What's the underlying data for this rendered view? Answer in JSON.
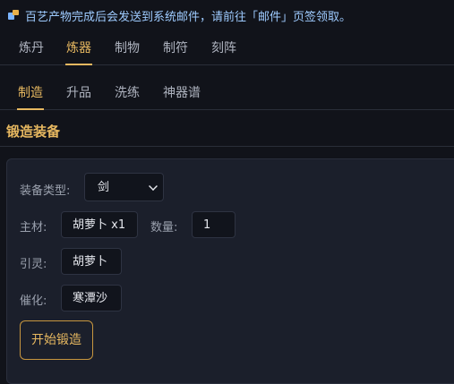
{
  "notice": {
    "text": "百艺产物完成后会发送到系统邮件，请前往「邮件」页签领取。",
    "icon": "mail-box-icon"
  },
  "main_tabs": [
    "炼丹",
    "炼器",
    "制物",
    "制符",
    "刻阵"
  ],
  "main_tab_active": "炼器",
  "sub_tabs": [
    "制造",
    "升品",
    "洗练",
    "神器谱"
  ],
  "sub_tab_active": "制造",
  "section": {
    "title": "锻造装备"
  },
  "form": {
    "equip_type_label": "装备类型:",
    "equip_type_value": "剑",
    "main_material_label": "主材:",
    "main_material_value": "胡萝卜 x1",
    "quantity_label": "数量:",
    "quantity_value": "1",
    "spirit_label": "引灵:",
    "spirit_value": "胡萝卜",
    "catalyst_label": "催化:",
    "catalyst_value": "寒潭沙",
    "start_button": "开始锻造"
  },
  "colors": {
    "accent": "#e7b860",
    "notice_text": "#9ecbff",
    "background": "#11131a",
    "panel": "#1b1f2b"
  }
}
